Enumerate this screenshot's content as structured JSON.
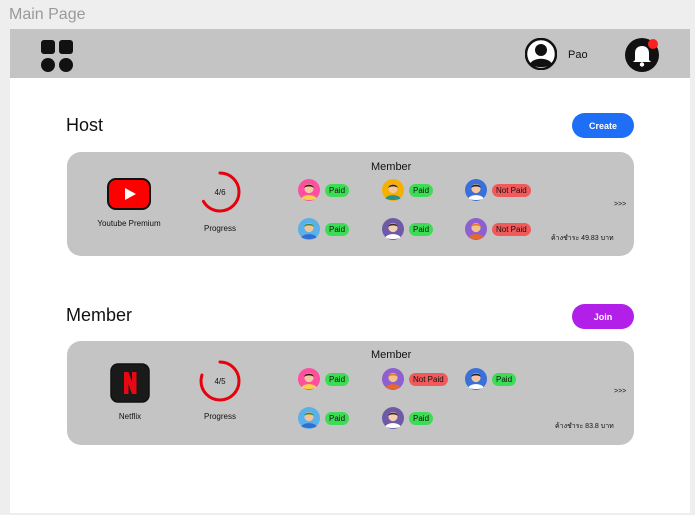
{
  "frame": {
    "title": "Main Page"
  },
  "header": {
    "user_name": "Pao"
  },
  "colors": {
    "create": "#1e6ff5",
    "join": "#b21fe8",
    "paid": "#3ddc55",
    "not_paid": "#f05a5a",
    "progress": "#e8000d"
  },
  "sections": [
    {
      "title": "Host",
      "action_label": "Create",
      "card": {
        "service": "Youtube Premium",
        "logo": "youtube-icon",
        "progress_text": "4/6",
        "progress_fraction": 0.667,
        "progress_label": "Progress",
        "members_heading": "Member",
        "members": [
          {
            "status": "Paid",
            "avatar": "girl-pink"
          },
          {
            "status": "Paid",
            "avatar": "boy-teal"
          },
          {
            "status": "Not Paid",
            "avatar": "girl-blue"
          },
          {
            "status": "Paid",
            "avatar": "boy-green"
          },
          {
            "status": "Paid",
            "avatar": "man-purple"
          },
          {
            "status": "Not Paid",
            "avatar": "boy-orange"
          }
        ],
        "more": ">>>",
        "cost": "ค้างชำระ 49.83 บาท"
      }
    },
    {
      "title": "Member",
      "action_label": "Join",
      "card": {
        "service": "Netflix",
        "logo": "netflix-icon",
        "progress_text": "4/5",
        "progress_fraction": 0.8,
        "progress_label": "Progress",
        "members_heading": "Member",
        "members": [
          {
            "status": "Paid",
            "avatar": "girl-pink"
          },
          {
            "status": "Not Paid",
            "avatar": "boy-orange"
          },
          {
            "status": "Paid",
            "avatar": "girl-blue"
          },
          {
            "status": "Paid",
            "avatar": "boy-green"
          },
          {
            "status": "Paid",
            "avatar": "man-purple"
          }
        ],
        "more": ">>>",
        "cost": "ค้างชำระ 83.8 บาท"
      }
    }
  ]
}
